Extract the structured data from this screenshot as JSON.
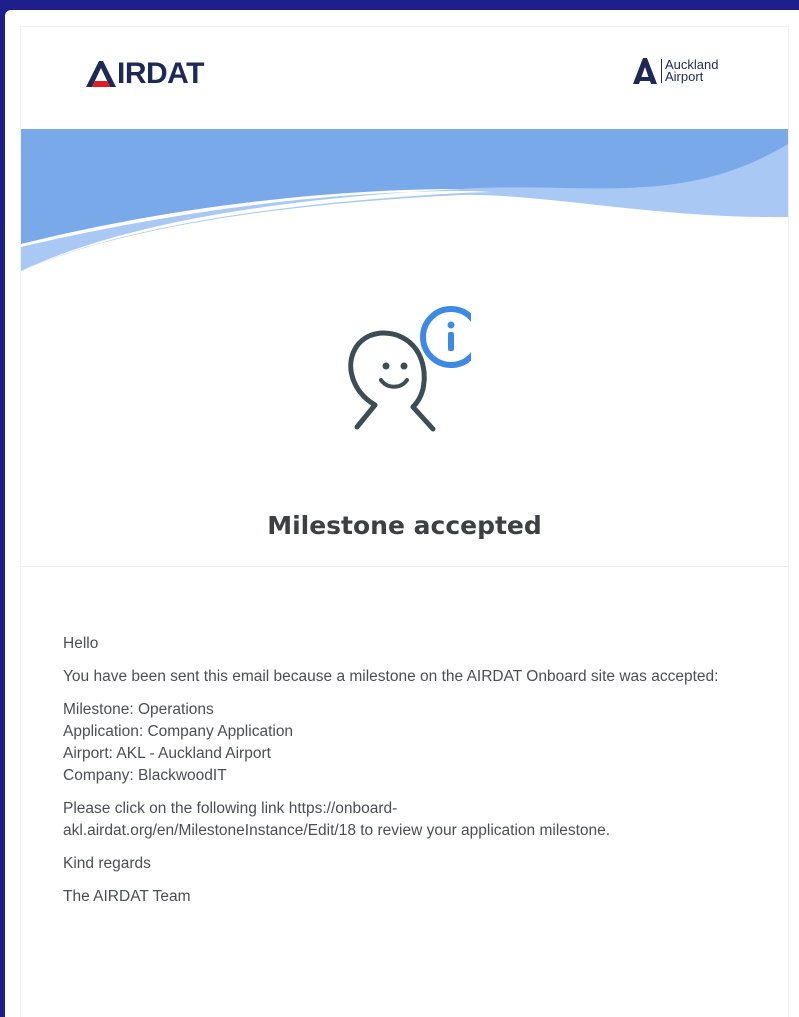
{
  "header": {
    "brand_left": "IRDAT",
    "brand_right_line1": "Auckland",
    "brand_right_line2": "Airport"
  },
  "hero": {
    "icon": "smiley-info-icon"
  },
  "title": "Milestone accepted",
  "email": {
    "greeting": "Hello",
    "intro": "You have been sent this email because a milestone on the AIRDAT Onboard site was accepted:",
    "details": [
      "Milestone: Operations",
      "Application: Company Application",
      "Airport: AKL - Auckland Airport",
      "Company: BlackwoodIT"
    ],
    "link_line1": "Please click on the following link https://onboard-",
    "link_line2": "akl.airdat.org/en/MilestoneInstance/Edit/18 to review your application milestone.",
    "closing": "Kind regards",
    "signature": "The AIRDAT Team"
  },
  "colors": {
    "page_border": "#1c1f8c",
    "wave_dark": "#7aa9ea",
    "wave_light": "#a9c9f4",
    "icon_blue": "#3d8ae6",
    "icon_dark": "#3d4d55",
    "brand_navy": "#1e2a56",
    "brand_red": "#e21b23"
  }
}
